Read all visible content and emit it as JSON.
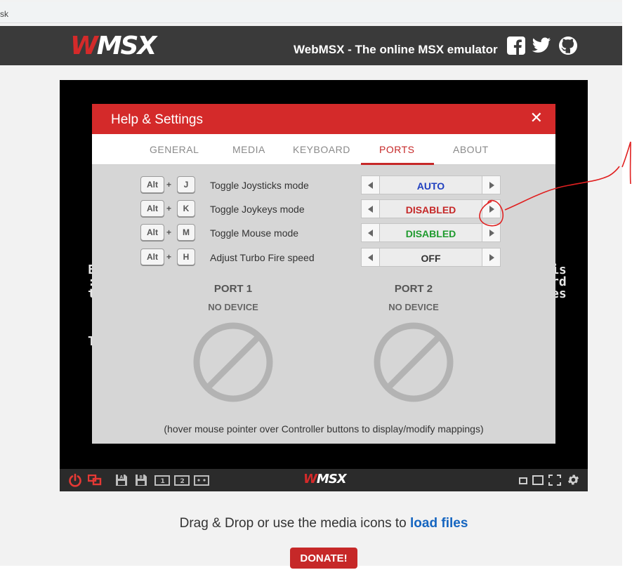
{
  "browser": {
    "address_text": "sk"
  },
  "header": {
    "logo_text": "MSX",
    "logo_prefix": "W",
    "site_title": "WebMSX - The online MSX emulator",
    "social_icons": [
      "facebook-icon",
      "twitter-icon",
      "github-icon"
    ]
  },
  "emulator_background_text": {
    "left": [
      "E",
      ":",
      "t",
      "",
      "",
      "",
      "T"
    ],
    "right": [
      "is",
      "rd",
      "es"
    ]
  },
  "dialog": {
    "title": "Help & Settings",
    "close_glyph": "✕",
    "tabs": [
      {
        "label": "GENERAL",
        "active": false
      },
      {
        "label": "MEDIA",
        "active": false
      },
      {
        "label": "KEYBOARD",
        "active": false
      },
      {
        "label": "PORTS",
        "active": true
      },
      {
        "label": "ABOUT",
        "active": false
      }
    ],
    "settings": [
      {
        "modifier": "Alt",
        "plus": "+",
        "key": "J",
        "label": "Toggle Joysticks mode",
        "value": "AUTO",
        "value_color": "#1f3fbf"
      },
      {
        "modifier": "Alt",
        "plus": "+",
        "key": "K",
        "label": "Toggle Joykeys mode",
        "value": "DISABLED",
        "value_color": "#c62828"
      },
      {
        "modifier": "Alt",
        "plus": "+",
        "key": "M",
        "label": "Toggle Mouse mode",
        "value": "DISABLED",
        "value_color": "#1f9b2e"
      },
      {
        "modifier": "Alt",
        "plus": "+",
        "key": "H",
        "label": "Adjust Turbo Fire speed",
        "value": "OFF",
        "value_color": "#333333"
      }
    ],
    "ports": [
      {
        "title": "PORT 1",
        "device": "NO DEVICE"
      },
      {
        "title": "PORT 2",
        "device": "NO DEVICE"
      }
    ],
    "hint": "(hover mouse pointer over Controller buttons to display/modify mappings)"
  },
  "emulator_bar": {
    "logo_prefix": "W",
    "logo_text": "MSX",
    "left_icons": [
      "power-icon",
      "devices-icon",
      "disk-a-icon",
      "disk-b-icon",
      "cartridge-1-icon",
      "cartridge-2-icon",
      "tape-icon"
    ],
    "right_icons": [
      "small-window-icon",
      "window-icon",
      "fullscreen-icon",
      "settings-gear-icon"
    ]
  },
  "footer": {
    "drop_text": "Drag & Drop or use the media icons to ",
    "drop_link": "load files",
    "donate_label": "DONATE!"
  },
  "colors": {
    "brand_red": "#d42a2a",
    "header_bg": "#3a3a3a",
    "annotation_red": "#e02020"
  }
}
